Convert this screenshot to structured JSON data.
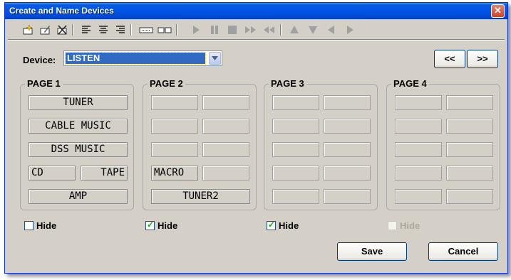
{
  "window": {
    "title": "Create and Name Devices",
    "close_label": "✕"
  },
  "toolbar": {
    "icons": [
      "new-device-icon",
      "rename-device-icon",
      "delete-device-icon",
      "align-left-icon",
      "align-center-icon",
      "align-right-icon",
      "single-button-icon",
      "double-button-icon",
      "play-icon",
      "pause-icon",
      "stop-icon",
      "fast-forward-icon",
      "rewind-icon",
      "arrow-up-icon",
      "arrow-down-icon",
      "arrow-left-icon",
      "arrow-right-icon"
    ]
  },
  "device": {
    "label": "Device:",
    "selected": "LISTEN"
  },
  "nav": {
    "prev_label": "<<",
    "next_label": ">>"
  },
  "pages": [
    {
      "title": "PAGE 1",
      "rows": [
        [
          "TUNER"
        ],
        [
          "CABLE MUSIC"
        ],
        [
          "DSS MUSIC"
        ],
        [
          "CD",
          "TAPE"
        ],
        [
          "AMP"
        ]
      ],
      "hide_label": "Hide",
      "hide_checked": false,
      "hide_enabled": true
    },
    {
      "title": "PAGE 2",
      "rows": [
        [
          "",
          ""
        ],
        [
          "",
          ""
        ],
        [
          "",
          ""
        ],
        [
          "MACRO",
          ""
        ],
        [
          "TUNER2"
        ]
      ],
      "hide_label": "Hide",
      "hide_checked": true,
      "hide_enabled": true
    },
    {
      "title": "PAGE 3",
      "rows": [
        [
          "",
          ""
        ],
        [
          "",
          ""
        ],
        [
          "",
          ""
        ],
        [
          "",
          ""
        ],
        [
          "",
          ""
        ]
      ],
      "hide_label": "Hide",
      "hide_checked": true,
      "hide_enabled": true
    },
    {
      "title": "PAGE 4",
      "rows": [
        [
          "",
          ""
        ],
        [
          "",
          ""
        ],
        [
          "",
          ""
        ],
        [
          "",
          ""
        ],
        [
          "",
          ""
        ]
      ],
      "hide_label": "Hide",
      "hide_checked": false,
      "hide_enabled": false
    }
  ],
  "buttons": {
    "save_label": "Save",
    "cancel_label": "Cancel"
  },
  "colors": {
    "title_bar": "#0055e5",
    "dialog_bg": "#d4d0c8",
    "selection": "#316ac5",
    "check_tick": "#21a121"
  }
}
